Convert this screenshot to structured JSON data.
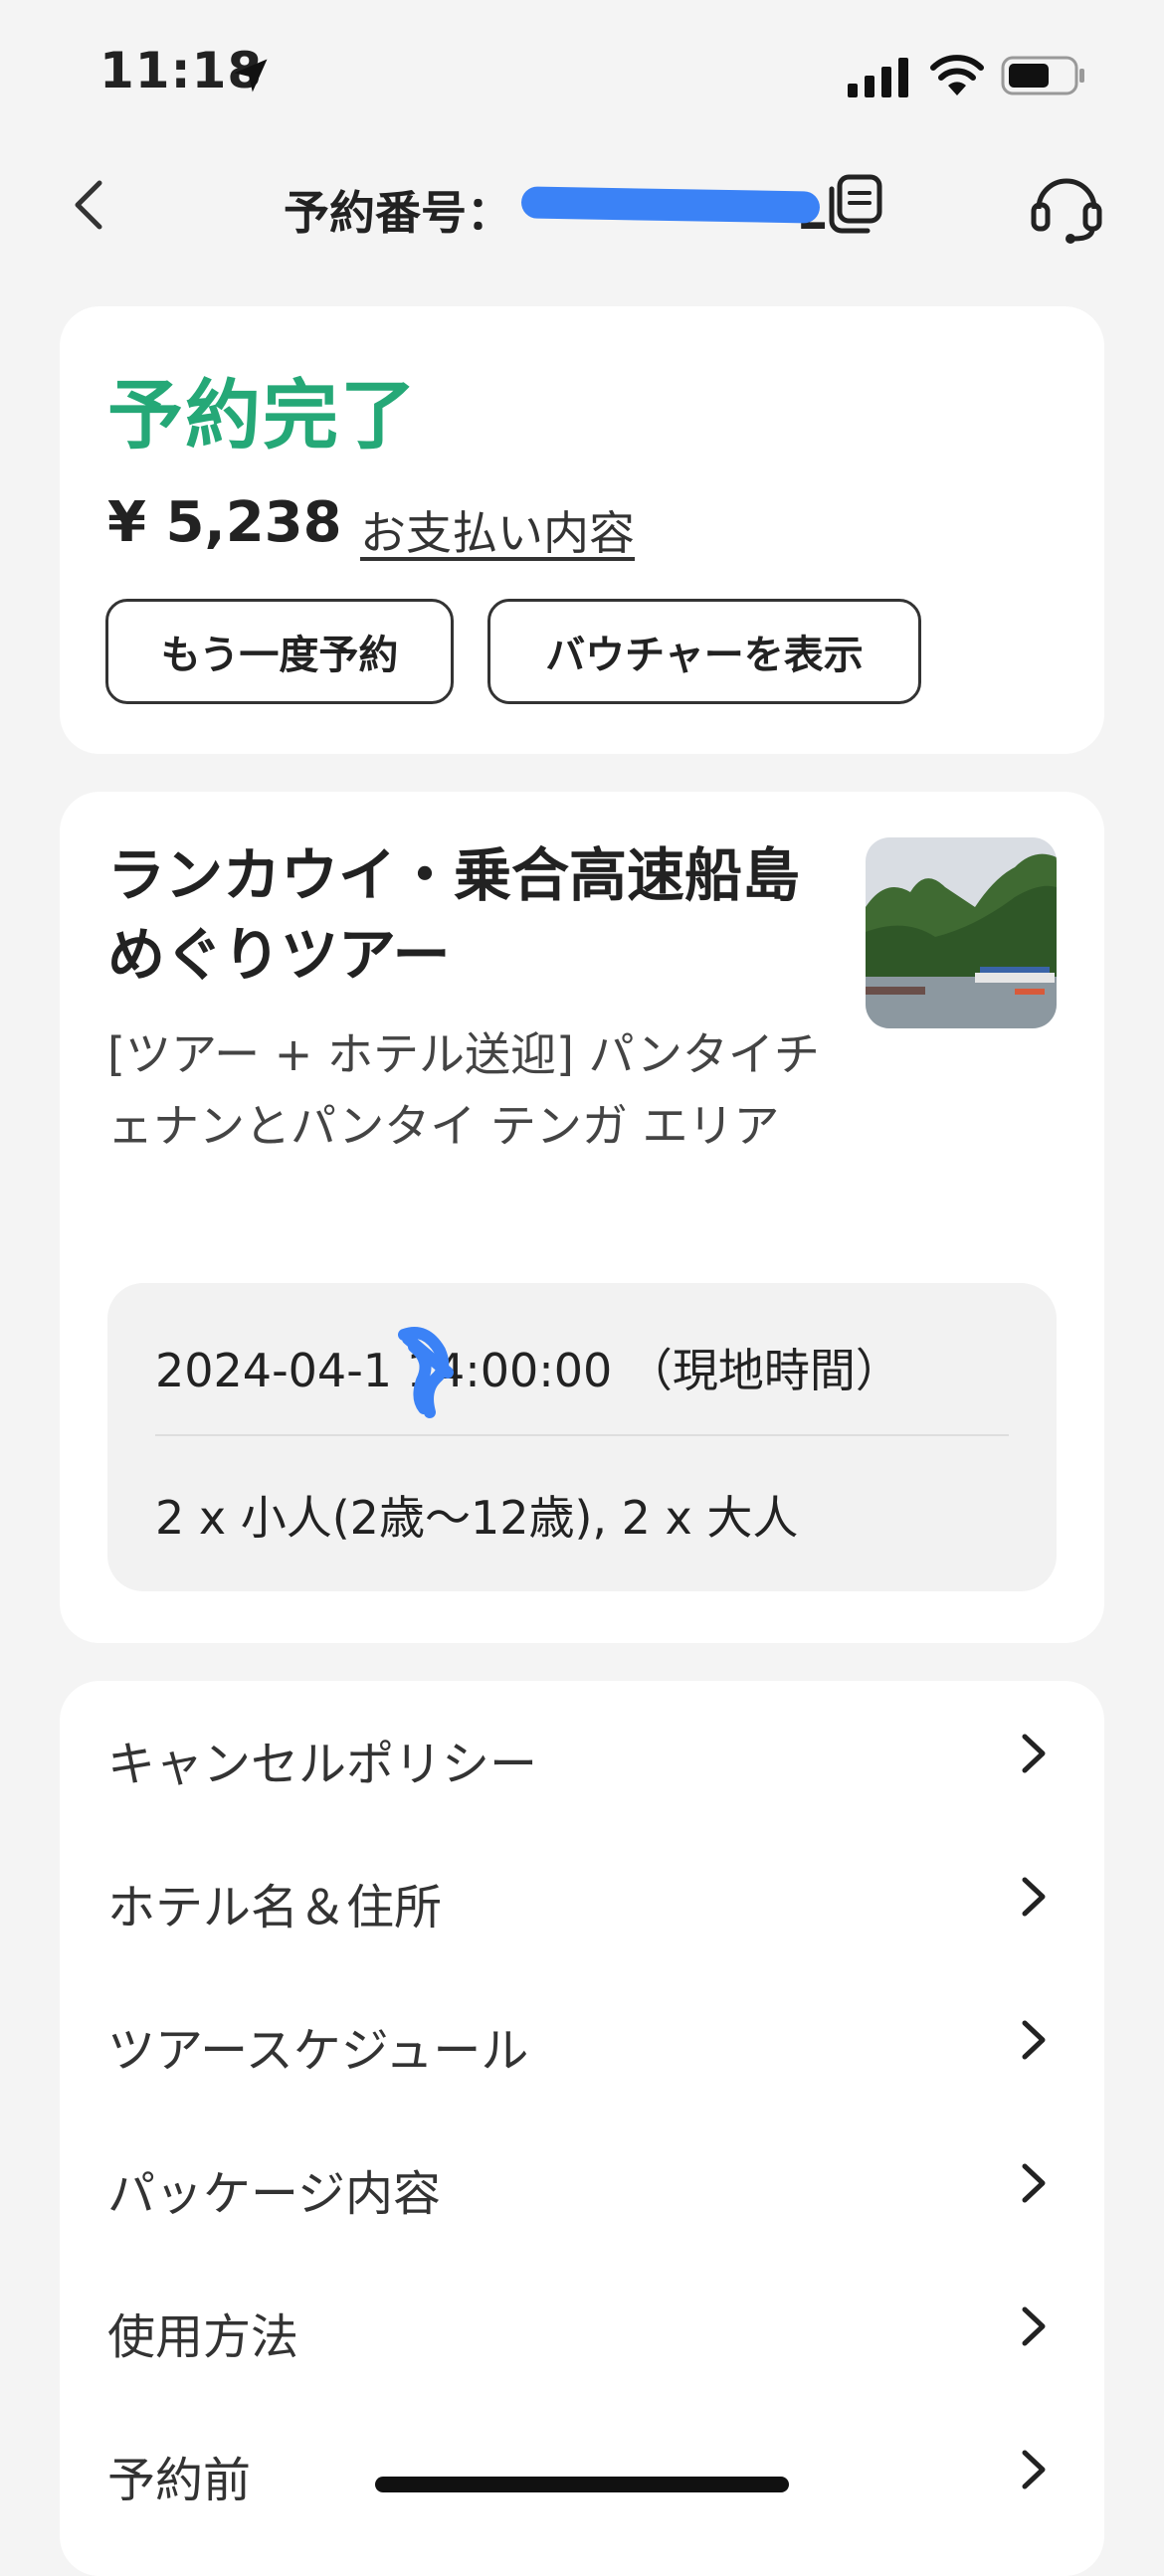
{
  "status_bar": {
    "time": "11:18",
    "icons": [
      "location-arrow-icon",
      "cellular-signal-icon",
      "wifi-icon",
      "battery-icon"
    ]
  },
  "nav": {
    "title_prefix": "予約番号：",
    "booking_number_visible": "L",
    "icons": [
      "back-chevron-icon",
      "copy-icon",
      "headset-support-icon"
    ]
  },
  "summary": {
    "status": "予約完了",
    "status_color": "#25a877",
    "price": "¥ 5,238",
    "payment_link": "お支払い内容",
    "rebook_button": "もう一度予約",
    "voucher_button": "バウチャーを表示"
  },
  "tour": {
    "title": "ランカウイ・乗合高速船島めぐりツアー",
    "subtitle": "[ツアー + ホテル送迎] パンタイチェナンとパンタイ テンガ エリア",
    "datetime": "2024-04-1  14:00:00 （現地時間）",
    "pax": "2 x 小人(2歳〜12歳), 2 x 大人"
  },
  "menu": [
    {
      "label": "キャンセルポリシー"
    },
    {
      "label": "ホテル名＆住所"
    },
    {
      "label": "ツアースケジュール"
    },
    {
      "label": "パッケージ内容"
    },
    {
      "label": "使用方法"
    },
    {
      "label": "予約前"
    }
  ],
  "colors": {
    "redaction": "#3b82f6",
    "card_bg": "#ffffff",
    "page_bg": "#f4f4f4"
  }
}
